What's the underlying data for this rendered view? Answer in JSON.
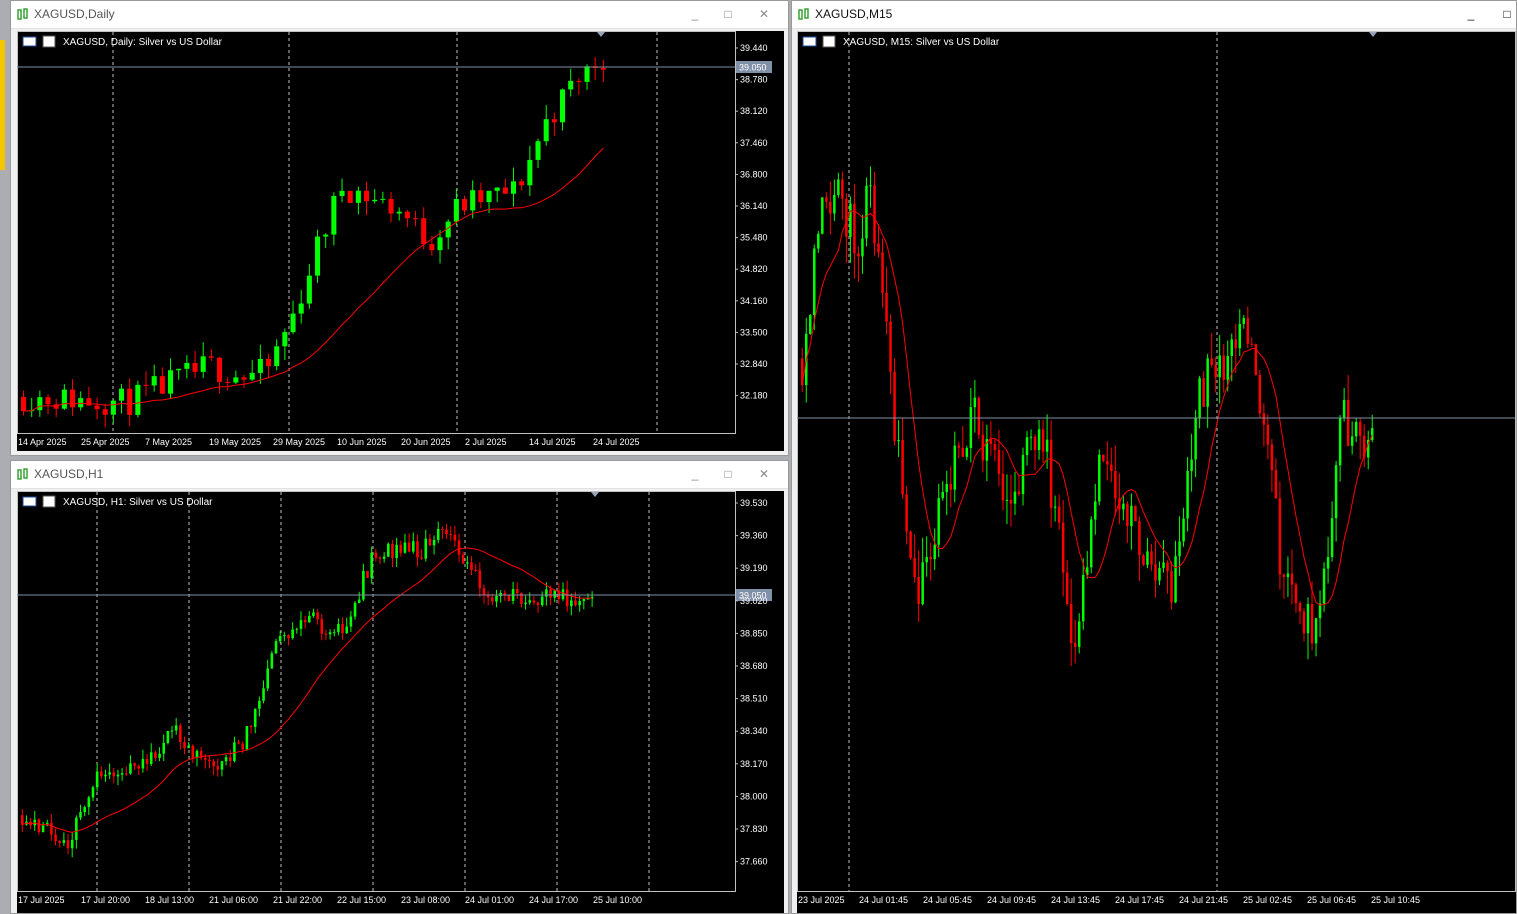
{
  "windows": [
    {
      "id": "daily",
      "title": "XAGUSD,Daily",
      "description": "XAGUSD, Daily:  Silver vs US Dollar",
      "current_price": "39.050",
      "buttons": {
        "minimize": "_",
        "maximize": "□",
        "close": "✕"
      },
      "colors": {
        "bull": "#00ff00",
        "bear": "#ff0000",
        "ma": "#ff0000",
        "bg": "#000000"
      }
    },
    {
      "id": "h1",
      "title": "XAGUSD,H1",
      "description": "XAGUSD, H1:  Silver vs US Dollar",
      "current_price": "39.050",
      "buttons": {
        "minimize": "_",
        "maximize": "□",
        "close": "✕"
      }
    },
    {
      "id": "m15",
      "title": "XAGUSD,M15",
      "description": "XAGUSD, M15:  Silver vs US Dollar",
      "buttons": {
        "minimize": "_",
        "maximize": "□"
      }
    }
  ],
  "chart_data": [
    {
      "type": "candlestick",
      "title": "XAGUSD, Daily:  Silver vs US Dollar",
      "ylim": [
        31.9,
        39.65
      ],
      "y_ticks": [
        "39.440",
        "38.780",
        "38.120",
        "37.460",
        "36.800",
        "36.140",
        "35.480",
        "34.820",
        "34.160",
        "33.500",
        "32.840",
        "32.180"
      ],
      "x_ticks": [
        "14 Apr 2025",
        "25 Apr 2025",
        "7 May 2025",
        "19 May 2025",
        "29 May 2025",
        "10 Jun 2025",
        "20 Jun 2025",
        "2 Jul 2025",
        "14 Jul 2025",
        "24 Jul 2025"
      ],
      "current_price": 39.05,
      "series": [
        {
          "name": "Moving Average",
          "start": 32.66,
          "end": 37.7
        }
      ],
      "candles_approx": {
        "count": 72,
        "start_close": 32.4,
        "end_close": 39.05,
        "high": 39.5,
        "low": 31.95
      }
    },
    {
      "type": "candlestick",
      "title": "XAGUSD, H1:  Silver vs US Dollar",
      "ylim": [
        37.5,
        39.6
      ],
      "y_ticks": [
        "39.530",
        "39.360",
        "39.190",
        "39.020",
        "38.850",
        "38.680",
        "38.510",
        "38.340",
        "38.170",
        "38.000",
        "37.830",
        "37.660"
      ],
      "x_ticks": [
        "17 Jul 2025",
        "17 Jul 20:00",
        "18 Jul 13:00",
        "21 Jul 06:00",
        "21 Jul 22:00",
        "22 Jul 15:00",
        "23 Jul 08:00",
        "24 Jul 01:00",
        "24 Jul 17:00",
        "25 Jul 10:00"
      ],
      "current_price": 39.05,
      "candles_approx": {
        "count": 138,
        "start_close": 37.9,
        "end_close": 39.05,
        "high": 39.56,
        "low": 37.55
      }
    },
    {
      "type": "candlestick",
      "title": "XAGUSD, M15:  Silver vs US Dollar",
      "ylim": [
        38.1,
        39.55
      ],
      "x_ticks": [
        "23 Jul 2025",
        "24 Jul 01:45",
        "24 Jul 05:45",
        "24 Jul 09:45",
        "24 Jul 13:45",
        "24 Jul 17:45",
        "24 Jul 21:45",
        "25 Jul 02:45",
        "25 Jul 06:45",
        "25 Jul 10:45"
      ],
      "candles_approx": {
        "count": 143,
        "high": 39.45,
        "low": 38.15
      }
    }
  ]
}
